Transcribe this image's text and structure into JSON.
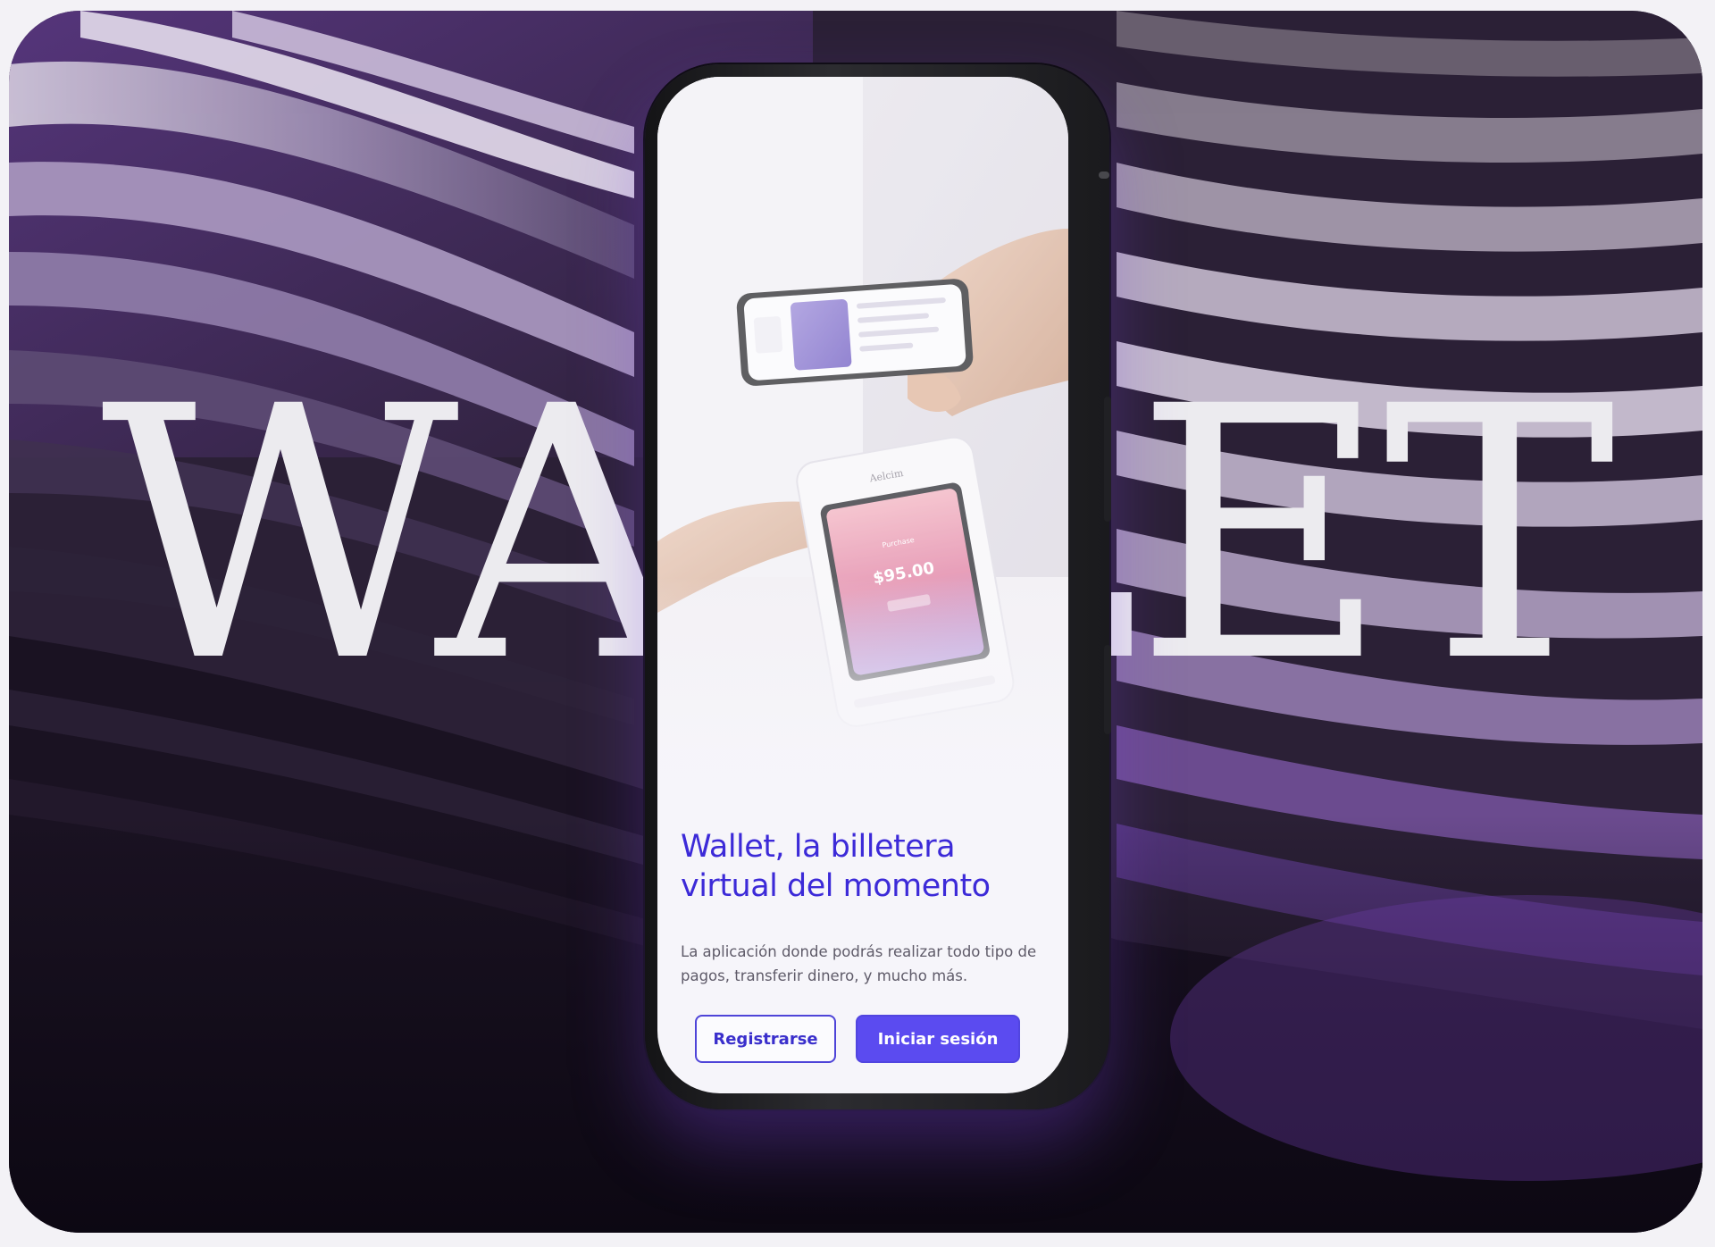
{
  "background": {
    "headline": "WALLET",
    "accent_color": "#6a3c9e"
  },
  "screen": {
    "illustration": {
      "terminal_brand": "Aelcim",
      "terminal_label": "Purchase",
      "terminal_amount": "$95.00"
    },
    "title": "Wallet, la billetera virtual del momento",
    "description": "La aplicación donde podrás realizar todo tipo de pagos, transferir dinero, y mucho más.",
    "buttons": {
      "register": "Registrarse",
      "login": "Iniciar sesión"
    }
  },
  "colors": {
    "brand": "#5b4bf0",
    "title": "#3c2ad8",
    "text": "#5f5b69"
  }
}
